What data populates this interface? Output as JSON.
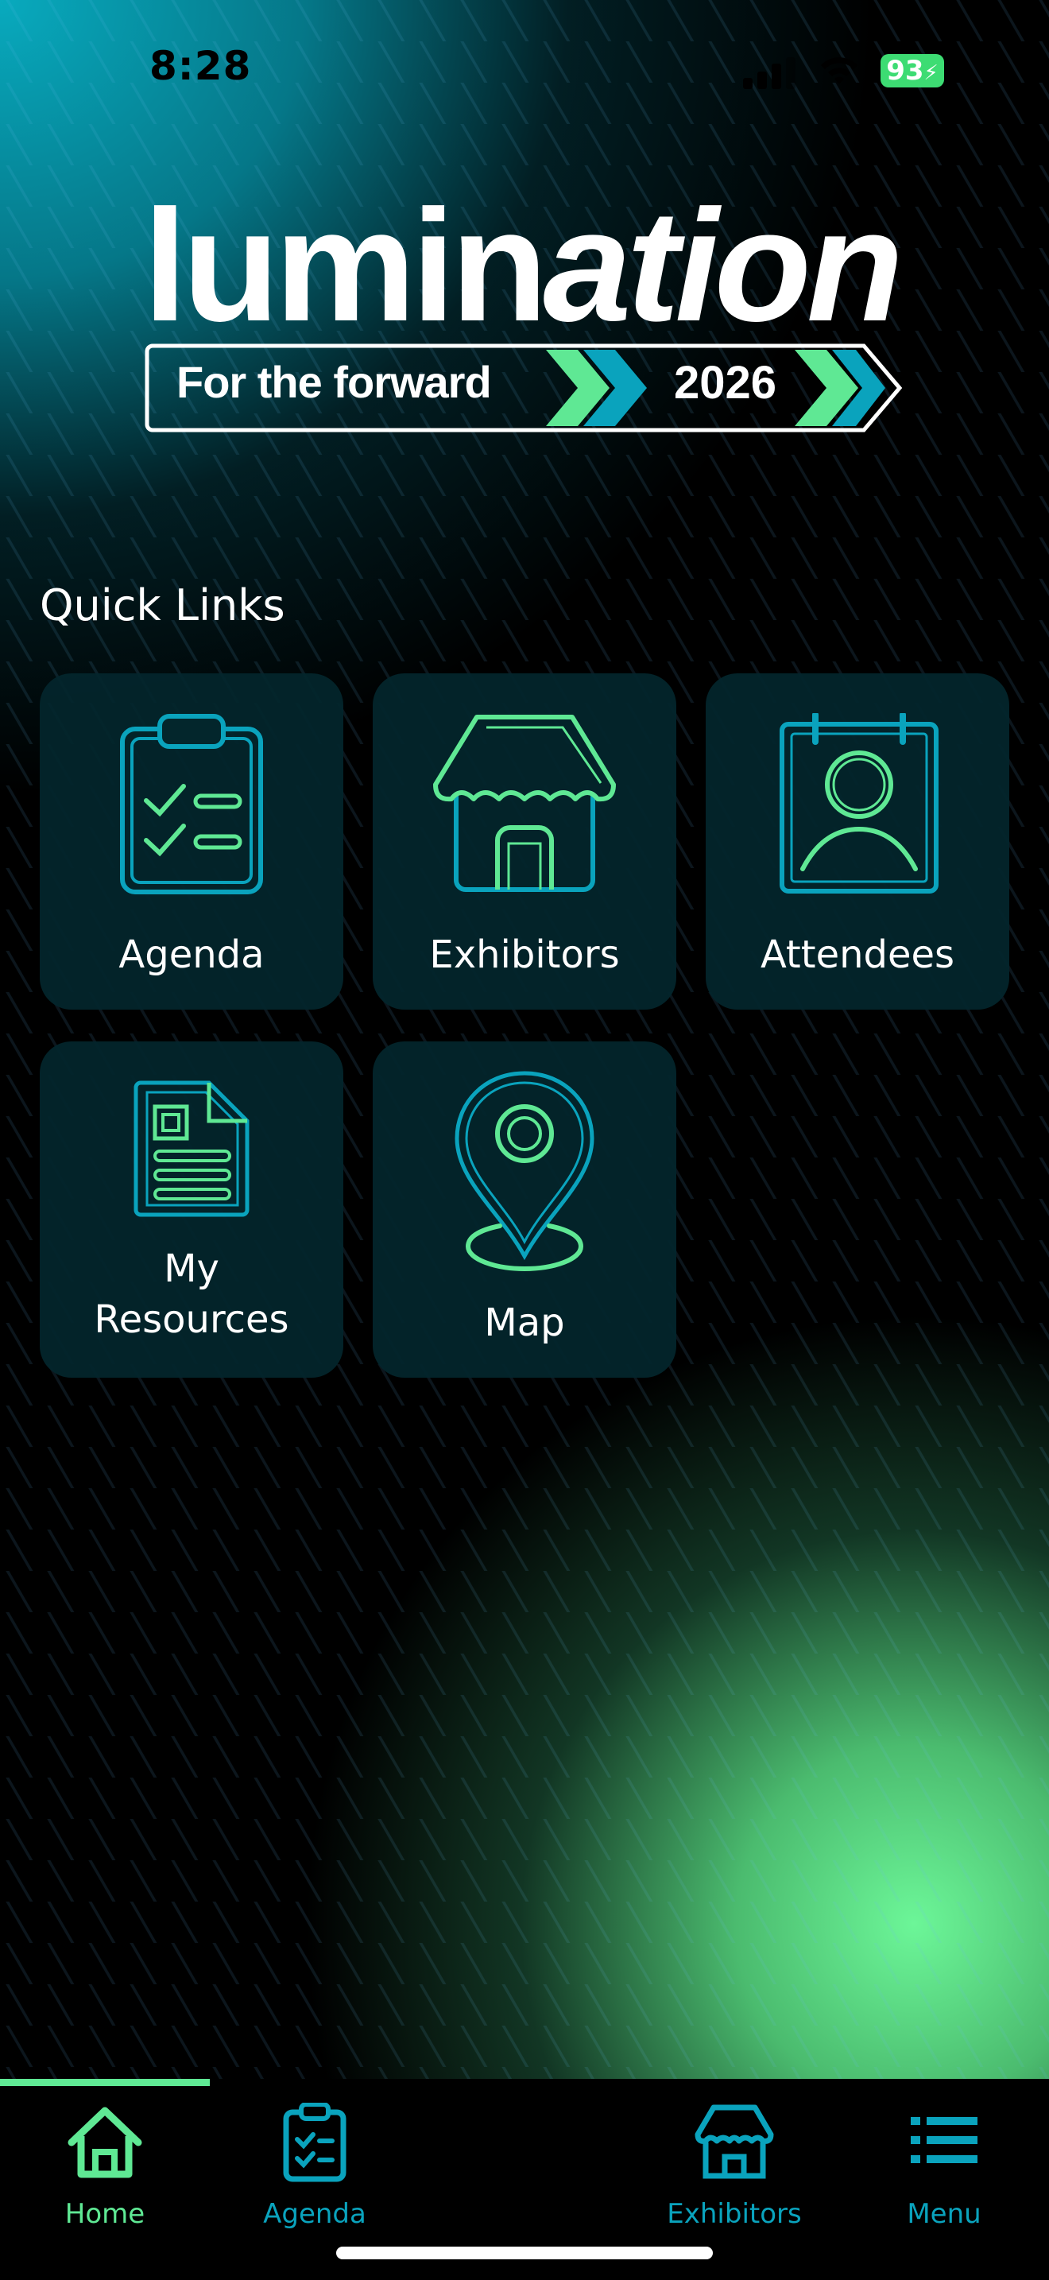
{
  "status_bar": {
    "time": "8:28",
    "battery": "93"
  },
  "logo": {
    "word_regular": "lumin",
    "word_italic": "ation",
    "tagline": "For the forward",
    "year": "2026"
  },
  "quick_links": {
    "title": "Quick Links",
    "items": [
      {
        "label": "Agenda",
        "icon": "clipboard-checklist-icon"
      },
      {
        "label": "Exhibitors",
        "icon": "storefront-icon"
      },
      {
        "label": "Attendees",
        "icon": "contact-card-icon"
      },
      {
        "label": "My\nResources",
        "icon": "document-icon"
      },
      {
        "label": "Map",
        "icon": "map-pin-icon"
      }
    ]
  },
  "tab_bar": {
    "active": "Home",
    "tabs": [
      {
        "label": "Home",
        "icon": "home-icon"
      },
      {
        "label": "Agenda",
        "icon": "clipboard-icon"
      },
      {
        "label": "Exhibitors",
        "icon": "storefront-icon"
      },
      {
        "label": "Menu",
        "icon": "list-icon"
      }
    ]
  },
  "colors": {
    "teal": "#0aa3bd",
    "green": "#5fe894",
    "tile_bg": "#03262c"
  }
}
